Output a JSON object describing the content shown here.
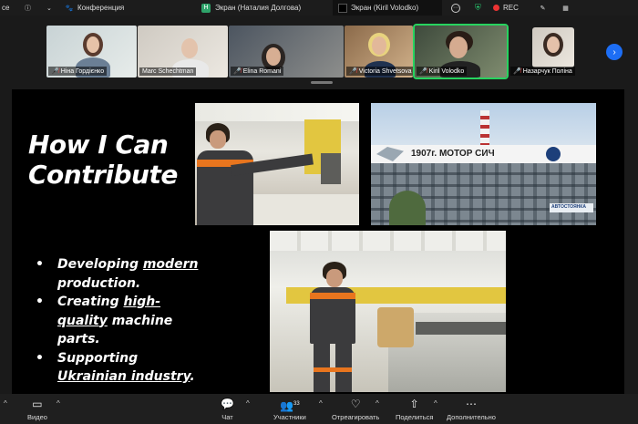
{
  "topbar": {
    "left_fragment": "ce",
    "info_icon": "info-icon",
    "chevron": "chevron-down-icon",
    "conference_tab": "Конференция",
    "screen_tab_1_badge": "H",
    "screen_tab_1": "Экран (Наталия Долгова)",
    "screen_tab_2": "Экран (Kiril Volodko)",
    "more": "…",
    "rec_label": "REC"
  },
  "participants": [
    {
      "name": "Ніна Гордієнко",
      "muted": true
    },
    {
      "name": "Marc Schechtman",
      "muted": false
    },
    {
      "name": "Elina Romani",
      "muted": true
    },
    {
      "name": "Victoria Shvetsova",
      "muted": true
    },
    {
      "name": "Kiril Volodko",
      "muted": true,
      "active": true
    },
    {
      "name": "Назарчук Поліна",
      "muted": true
    }
  ],
  "slide": {
    "title_line1": "How I Can",
    "title_line2": "Contribute",
    "bullets": [
      {
        "pre": "Developing ",
        "u": "modern",
        "post": " production."
      },
      {
        "pre": "Creating ",
        "u": "high-quality",
        "post": " machine parts."
      },
      {
        "pre": "Supporting ",
        "u": "Ukrainian industry",
        "post": "."
      }
    ],
    "sign_text": "1907г.  МОТОР  СИЧ",
    "sign_small": "АВТОСТОЯНКА"
  },
  "controls": {
    "video": "Видео",
    "chat": "Чат",
    "participants": "Участники",
    "participants_count": "33",
    "react": "Отреагировать",
    "share": "Поделиться",
    "more": "Дополнительно"
  },
  "colors": {
    "active_outline": "#27d35f",
    "rec_dot": "#ee3333",
    "next_button": "#1d6ef5",
    "worker_orange": "#e8751e"
  }
}
